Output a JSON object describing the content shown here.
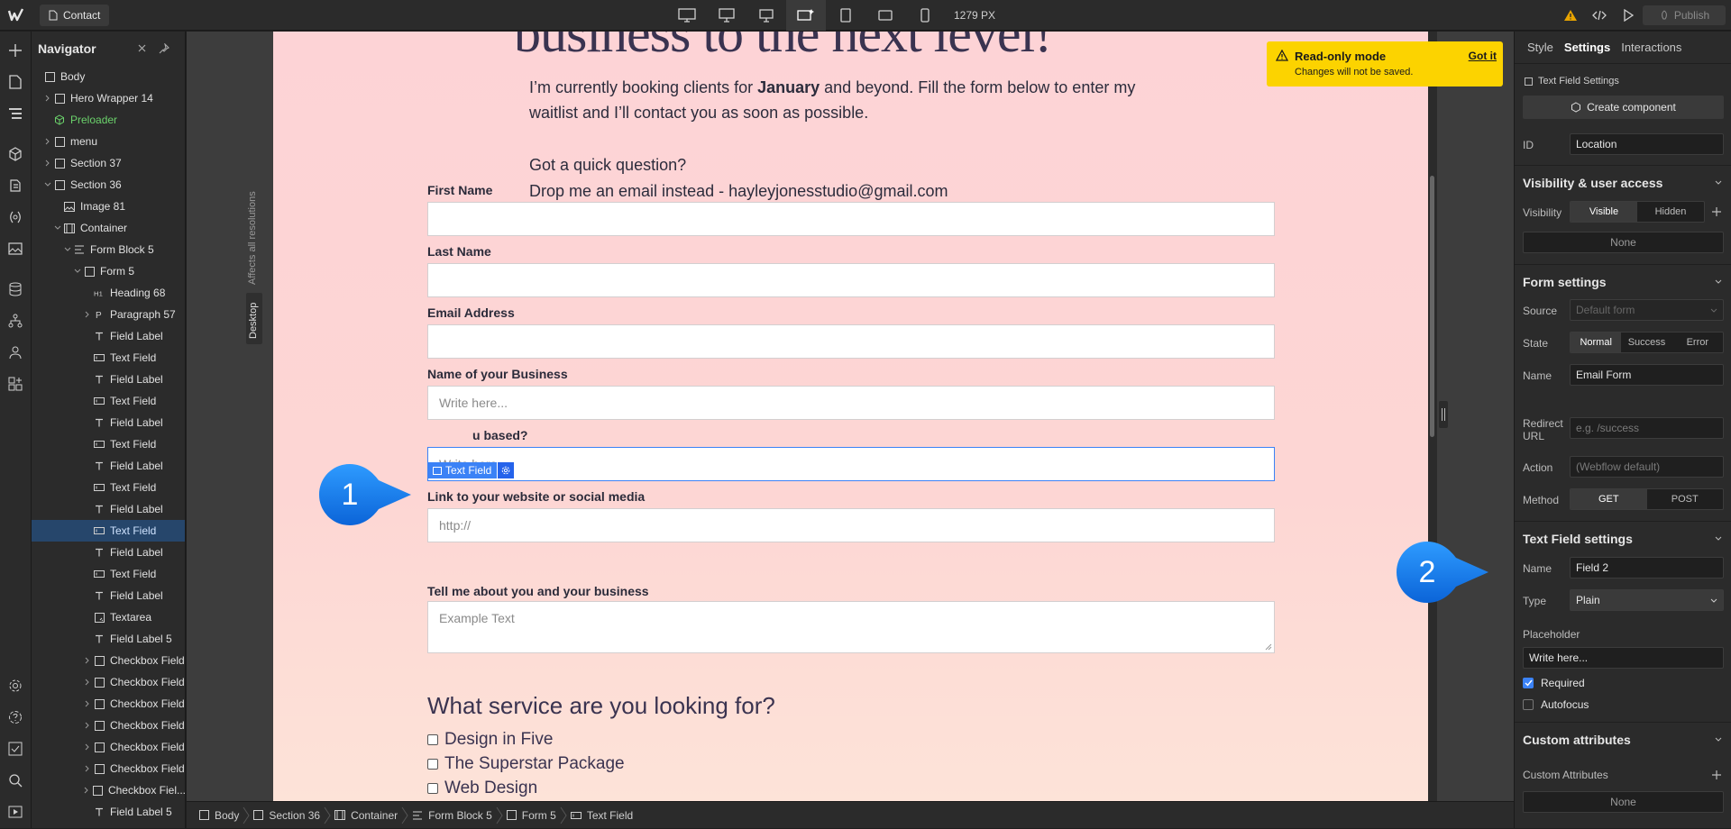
{
  "topbar": {
    "page_name": "Contact",
    "width_readout": "1279 PX",
    "publish_label": "Publish"
  },
  "navigator": {
    "title": "Navigator",
    "items": [
      {
        "label": "Body",
        "depth": 0,
        "icon": "box",
        "caret": ""
      },
      {
        "label": "Hero Wrapper 14",
        "depth": 1,
        "icon": "box",
        "caret": "right"
      },
      {
        "label": "Preloader",
        "depth": 1,
        "icon": "component",
        "caret": "",
        "component": true
      },
      {
        "label": "menu",
        "depth": 1,
        "icon": "box",
        "caret": "right"
      },
      {
        "label": "Section 37",
        "depth": 1,
        "icon": "box",
        "caret": "right"
      },
      {
        "label": "Section 36",
        "depth": 1,
        "icon": "box",
        "caret": "down"
      },
      {
        "label": "Image 81",
        "depth": 2,
        "icon": "image",
        "caret": ""
      },
      {
        "label": "Container",
        "depth": 2,
        "icon": "container",
        "caret": "down"
      },
      {
        "label": "Form Block 5",
        "depth": 3,
        "icon": "form",
        "caret": "down"
      },
      {
        "label": "Form 5",
        "depth": 4,
        "icon": "box",
        "caret": "down"
      },
      {
        "label": "Heading 68",
        "depth": 5,
        "icon": "h1",
        "caret": ""
      },
      {
        "label": "Paragraph 57",
        "depth": 5,
        "icon": "p",
        "caret": "right"
      },
      {
        "label": "Field Label",
        "depth": 5,
        "icon": "t",
        "caret": ""
      },
      {
        "label": "Text Field",
        "depth": 5,
        "icon": "field",
        "caret": ""
      },
      {
        "label": "Field Label",
        "depth": 5,
        "icon": "t",
        "caret": ""
      },
      {
        "label": "Text Field",
        "depth": 5,
        "icon": "field",
        "caret": ""
      },
      {
        "label": "Field Label",
        "depth": 5,
        "icon": "t",
        "caret": ""
      },
      {
        "label": "Text Field",
        "depth": 5,
        "icon": "field",
        "caret": ""
      },
      {
        "label": "Field Label",
        "depth": 5,
        "icon": "t",
        "caret": ""
      },
      {
        "label": "Text Field",
        "depth": 5,
        "icon": "field",
        "caret": ""
      },
      {
        "label": "Field Label",
        "depth": 5,
        "icon": "t",
        "caret": ""
      },
      {
        "label": "Text Field",
        "depth": 5,
        "icon": "field",
        "caret": "",
        "selected": true
      },
      {
        "label": "Field Label",
        "depth": 5,
        "icon": "t",
        "caret": ""
      },
      {
        "label": "Text Field",
        "depth": 5,
        "icon": "field",
        "caret": ""
      },
      {
        "label": "Field Label",
        "depth": 5,
        "icon": "t",
        "caret": ""
      },
      {
        "label": "Textarea",
        "depth": 5,
        "icon": "textarea",
        "caret": ""
      },
      {
        "label": "Field Label 5",
        "depth": 5,
        "icon": "t",
        "caret": ""
      },
      {
        "label": "Checkbox Field",
        "depth": 5,
        "icon": "box",
        "caret": "right"
      },
      {
        "label": "Checkbox Field",
        "depth": 5,
        "icon": "box",
        "caret": "right"
      },
      {
        "label": "Checkbox Field",
        "depth": 5,
        "icon": "box",
        "caret": "right"
      },
      {
        "label": "Checkbox Field",
        "depth": 5,
        "icon": "box",
        "caret": "right"
      },
      {
        "label": "Checkbox Field",
        "depth": 5,
        "icon": "box",
        "caret": "right"
      },
      {
        "label": "Checkbox Field",
        "depth": 5,
        "icon": "box",
        "caret": "right"
      },
      {
        "label": "Checkbox Fiel...",
        "depth": 5,
        "icon": "box",
        "caret": "right"
      },
      {
        "label": "Field Label 5",
        "depth": 5,
        "icon": "t",
        "caret": ""
      }
    ]
  },
  "canvas": {
    "affects_label": "Affects all resolutions",
    "desktop_label": "Desktop",
    "hero_title": "business to the next level!",
    "intro_line1_pre": "I’m currently booking clients for ",
    "intro_line1_bold": "January",
    "intro_line1_post": " and beyond. Fill the form below to enter my",
    "intro_line2": "waitlist and I’ll contact you as soon as possible.",
    "question_line": "Got a quick question?",
    "email_line": "Drop me an email instead - hayleyjonesstudio@gmail.com",
    "fields": [
      {
        "label": "First Name",
        "placeholder": ""
      },
      {
        "label": "Last Name",
        "placeholder": ""
      },
      {
        "label": "Email Address",
        "placeholder": ""
      },
      {
        "label": "Name of your Business",
        "placeholder": "Write here..."
      },
      {
        "label": "u based?",
        "placeholder": "Write here...",
        "selected": true
      },
      {
        "label": "Link to your website or social media",
        "placeholder": "http://"
      }
    ],
    "textarea_label": "Tell me about you and your business",
    "textarea_placeholder": "Example Text",
    "selected_badge": "Text Field",
    "service_heading": "What service are you looking for?",
    "services": [
      "Design in Five",
      "The Superstar Package",
      "Web Design"
    ]
  },
  "toast": {
    "title": "Read-only mode",
    "message": "Changes will not be saved.",
    "action": "Got it"
  },
  "callouts": [
    "1",
    "2"
  ],
  "breadcrumb": [
    {
      "label": "Body",
      "icon": "box"
    },
    {
      "label": "Section 36",
      "icon": "box"
    },
    {
      "label": "Container",
      "icon": "container"
    },
    {
      "label": "Form Block 5",
      "icon": "form"
    },
    {
      "label": "Form 5",
      "icon": "box"
    },
    {
      "label": "Text Field",
      "icon": "field"
    }
  ],
  "panel": {
    "tabs": [
      "Style",
      "Settings",
      "Interactions"
    ],
    "element_settings": "Text Field Settings",
    "create_component": "Create component",
    "id_label": "ID",
    "id_value": "Location",
    "visibility_section": "Visibility & user access",
    "visibility_label": "Visibility",
    "visibility_options": [
      "Visible",
      "Hidden"
    ],
    "visibility_none": "None",
    "form_section": "Form settings",
    "source_label": "Source",
    "source_value": "Default form",
    "state_label": "State",
    "state_options": [
      "Normal",
      "Success",
      "Error"
    ],
    "name_label": "Name",
    "form_name": "Email Form",
    "redirect_label": "Redirect URL",
    "redirect_placeholder": "e.g. /success",
    "action_label": "Action",
    "action_placeholder": "(Webflow default)",
    "method_label": "Method",
    "method_options": [
      "GET",
      "POST"
    ],
    "text_field_section": "Text Field settings",
    "field_name_label": "Name",
    "field_name": "Field 2",
    "type_label": "Type",
    "type_value": "Plain",
    "placeholder_label": "Placeholder",
    "placeholder_value": "Write here...",
    "required_label": "Required",
    "autofocus_label": "Autofocus",
    "custom_section": "Custom attributes",
    "custom_label": "Custom Attributes",
    "custom_none": "None"
  },
  "colors": {
    "accent": "#3b82f6",
    "toast": "#fcd300",
    "callout": "#1a7ff0",
    "component": "#6bd26b"
  }
}
